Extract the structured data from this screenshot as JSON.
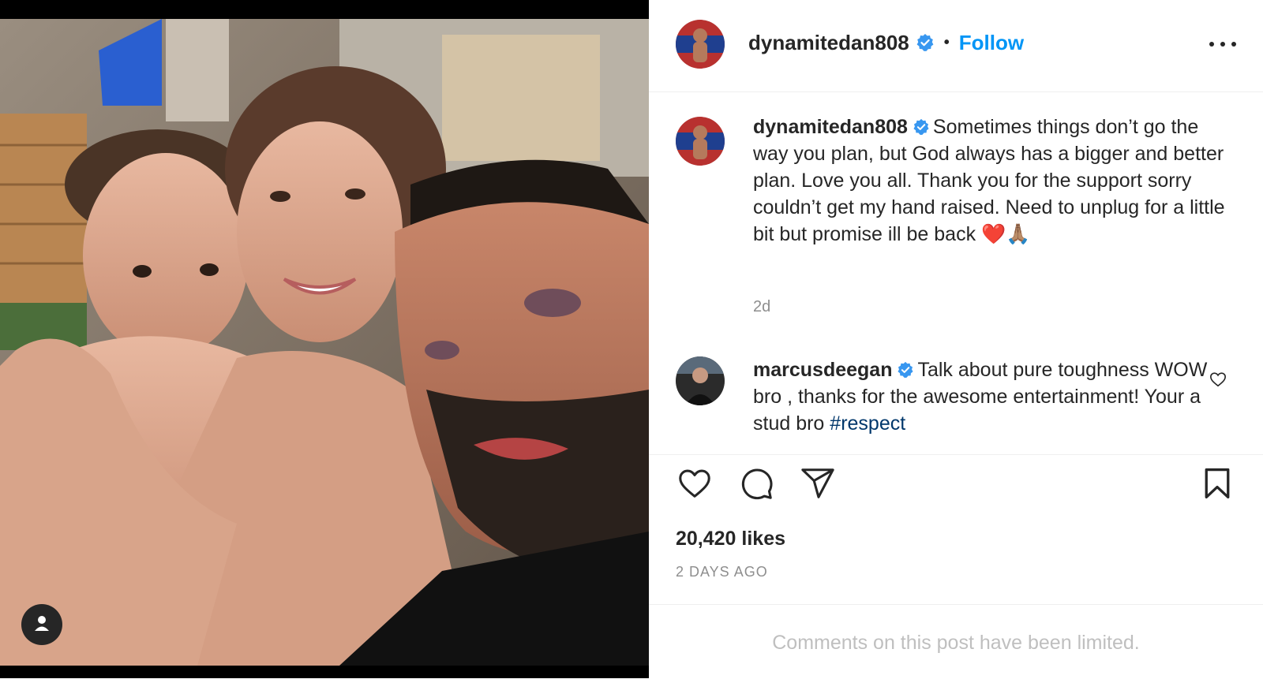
{
  "post": {
    "author": "dynamitedan808",
    "verified": true,
    "follow_label": "Follow",
    "separator": "•",
    "caption": "Sometimes things don’t go the way you plan, but God always has a bigger and better plan. Love you all. Thank you for the support sorry couldn’t get my hand raised. Need to unplug for a little bit but promise ill be back",
    "caption_emoji": "❤️🙏🏽",
    "caption_time": "2d",
    "likes": "20,420 likes",
    "date": "2 DAYS AGO",
    "comments_limited": "Comments on this post have been limited."
  },
  "comment": {
    "author": "marcusdeegan",
    "verified": true,
    "text": "Talk about pure toughness WOW bro , thanks for the awesome entertainment! Your a stud bro",
    "hashtag": "#respect"
  },
  "icons": {
    "header_more": "more-horizontal-icon",
    "verified": "verified-badge-icon",
    "like": "heart-icon",
    "comment": "comment-bubble-icon",
    "share": "paper-plane-icon",
    "save": "bookmark-icon",
    "tag_user": "user-tag-icon",
    "comment_like": "small-heart-icon"
  },
  "colors": {
    "link_blue": "#0095f6",
    "verified_blue": "#3897f0",
    "hashtag": "#00376b",
    "muted": "#8e8e8e",
    "text": "#262626"
  }
}
